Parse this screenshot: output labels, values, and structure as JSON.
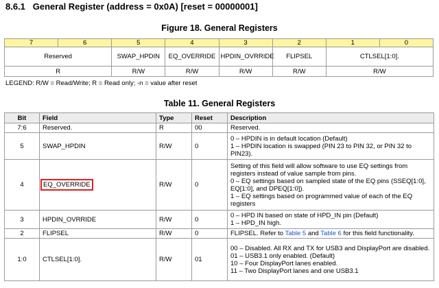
{
  "section": {
    "number": "8.6.1",
    "title": "General Register (address = 0x0A) [reset = 00000001]"
  },
  "figure": {
    "caption": "Figure 18.  General Registers",
    "bits": [
      "7",
      "6",
      "5",
      "4",
      "3",
      "2",
      "1",
      "0"
    ],
    "fields": [
      "Reserved",
      "SWAP_HPDIN",
      "EQ_OVERRIDE",
      "HPDIN_OVRRIDE",
      "FLIPSEL",
      "CTLSEL[1:0]."
    ],
    "access": [
      "R",
      "R/W",
      "R/W",
      "R/W",
      "R/W",
      "R/W"
    ]
  },
  "legend": "LEGEND: R/W = Read/Write; R = Read only; -n = value after reset",
  "table": {
    "caption": "Table 11. General Registers",
    "headers": [
      "Bit",
      "Field",
      "Type",
      "Reset",
      "Description"
    ],
    "rows": [
      {
        "bit": "7:6",
        "field": "Reserved.",
        "type": "R",
        "reset": "00",
        "description": [
          "Reserved."
        ]
      },
      {
        "bit": "5",
        "field": "SWAP_HPDIN",
        "type": "R/W",
        "reset": "0",
        "description": [
          "0 – HPDIN is in default location (Default)",
          "1 – HPDIN location is swapped (PIN 23 to PIN 32, or PIN 32 to PIN23)."
        ]
      },
      {
        "bit": "4",
        "field": "EQ_OVERRIDE",
        "type": "R/W",
        "reset": "0",
        "description": [
          "Setting of this field will allow software to use EQ settings from registers instead of value sample from pins.",
          "0 – EQ settings based on sampled state of the EQ pins (SSEQ[1:0], EQ[1:0], and DPEQ[1:0]).",
          "1 – EQ settings based on programmed value of each of the EQ registers"
        ]
      },
      {
        "bit": "3",
        "field": "HPDIN_OVRRIDE",
        "type": "R/W",
        "reset": "0",
        "description": [
          "0 – HPD IN based on state of HPD_IN pin (Default)",
          "1 – HPD_IN high."
        ]
      },
      {
        "bit": "2",
        "field": "FLIPSEL",
        "type": "R/W",
        "reset": "0",
        "description_parts": {
          "pre": "FLIPSEL. Refer to ",
          "link1": "Table 5",
          "mid": " and ",
          "link2": "Table 6",
          "post": " for this field functionality."
        }
      },
      {
        "bit": "1:0",
        "field": "CTLSEL[1:0].",
        "type": "R/W",
        "reset": "01",
        "description": [
          "00 – Disabled. All RX and TX for USB3 and DisplayPort are disabled.",
          "01 – USB3.1 only enabled. (Default)",
          "10 – Four DisplayPort lanes enabled.",
          "11 – Two DisplayPort lanes and one USB3.1"
        ]
      }
    ]
  },
  "colors": {
    "bit_row_bg": "#fff5a0",
    "highlight": "#e02020",
    "link": "#1a55c9",
    "header_bg": "#ececec"
  }
}
